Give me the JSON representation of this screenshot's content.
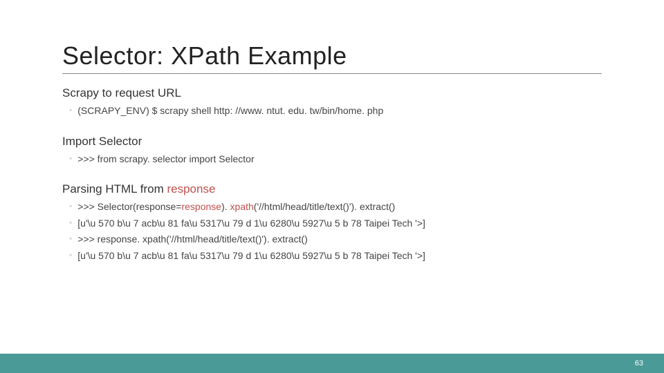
{
  "title": "Selector: XPath Example",
  "sections": [
    {
      "heading": "Scrapy to request URL",
      "items": [
        {
          "text": "(SCRAPY_ENV) $ scrapy shell http: //www. ntut. edu. tw/bin/home. php"
        }
      ]
    },
    {
      "heading": "Import Selector",
      "items": [
        {
          "text": ">>> from scrapy. selector import Selector"
        }
      ]
    },
    {
      "heading_parts": [
        "Parsing HTML from ",
        "response"
      ],
      "items": [
        {
          "parts": [
            ">>> Selector(response=",
            "response",
            "). ",
            "xpath",
            "('//html/head/title/text()'). extract()"
          ]
        },
        {
          "text": "[u'\\u 570 b\\u 7 acb\\u 81 fa\\u 5317\\u 79 d 1\\u 6280\\u 5927\\u 5 b 78 Taipei Tech '>]"
        },
        {
          "text": ">>> response. xpath('//html/head/title/text()'). extract()"
        },
        {
          "text": "[u'\\u 570 b\\u 7 acb\\u 81 fa\\u 5317\\u 79 d 1\\u 6280\\u 5927\\u 5 b 78 Taipei Tech '>]"
        }
      ]
    }
  ],
  "page_number": "63"
}
